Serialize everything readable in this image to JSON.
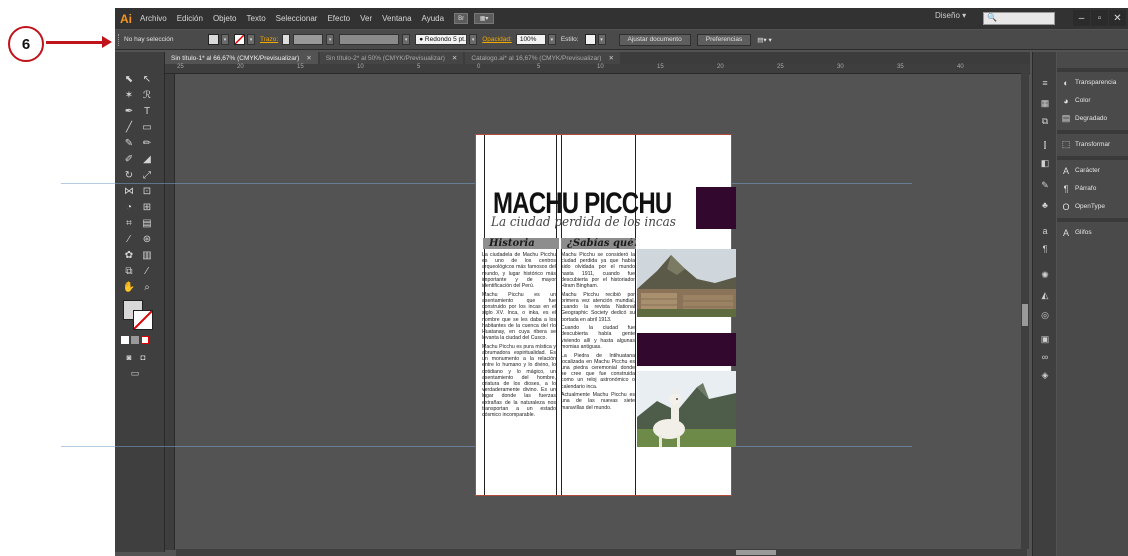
{
  "callout": {
    "number": "6"
  },
  "app": {
    "logo": "Ai",
    "menu": [
      "Archivo",
      "Edición",
      "Objeto",
      "Texto",
      "Seleccionar",
      "Efecto",
      "Ver",
      "Ventana",
      "Ayuda"
    ],
    "menu_buttons": [
      "Br",
      "▦▾"
    ],
    "workspace": "Diseño ▾",
    "search_placeholder": "🔍",
    "window_buttons": [
      "–",
      "▫",
      "✕"
    ]
  },
  "control_bar": {
    "selection": "No hay selección",
    "stroke_label": "Trazo:",
    "brush": "● Redondo 5 pt.",
    "opacity_label": "Opacidad:",
    "opacity_value": "100%",
    "style_label": "Estilo:",
    "doc_setup": "Ajustar documento",
    "prefs": "Preferencias",
    "arrange": "▤▾ ▾"
  },
  "tabs": [
    {
      "label": "Sin título-1* al 66,67% (CMYK/Previsualizar)",
      "close": "✕"
    },
    {
      "label": "Sin título-2* al 50% (CMYK/Previsualizar)",
      "close": "✕"
    },
    {
      "label": "Catalogo.ai* al 16,67% (CMYK/Previsualizar)",
      "close": "✕"
    }
  ],
  "ruler_labels": [
    "25",
    "20",
    "15",
    "10",
    "5",
    "0",
    "5",
    "10",
    "15",
    "20",
    "25",
    "30",
    "35",
    "40"
  ],
  "panels": [
    {
      "icon": "◐",
      "label": "Transparencia"
    },
    {
      "icon": "◕",
      "label": "Color"
    },
    {
      "icon": "▤",
      "label": "Degradado"
    },
    {
      "icon": "⬚",
      "label": "Transformar"
    },
    {
      "icon": "A",
      "label": "Carácter"
    },
    {
      "icon": "¶",
      "label": "Párrafo"
    },
    {
      "icon": "O",
      "label": "OpenType"
    },
    {
      "icon": "A",
      "label": "Glifos"
    }
  ],
  "document": {
    "title": "MACHU PICCHU",
    "subtitle": "La ciudad perdida de los incas",
    "col1_heading": "Historia",
    "col2_heading": "¿Sabías qué?",
    "col1_paragraphs": [
      "La ciudadela de Machu Picchu es uno de los centros arqueológicos más famosos del mundo, y lugar histórico más importante y de mayor identificación del Perú.",
      "Machu Picchu es un asentamiento que fue construido por los incas en el siglo XV. Inca, o inka, es el nombre que se les daba a los habitantes de la cuenca del río Huatanay, en cuya ribera se levanta la ciudad del Cusco.",
      "Machu Picchu es pura mística y abrumadora espiritualidad. Es un monumento a la relación entre lo humano y lo divino, lo cotidiano y lo mágico, un asentamiento del hombre, criatura de los dioses, a lo verdaderamente divino. Es un lugar donde las fuerzas extrañas de la naturaleza nos transportan a un estado cósmico incomparable."
    ],
    "col2_paragraphs": [
      "Machu Picchu se consideró la ciudad perdida ya que había sido olvidada por el mundo hasta 1911, cuando fue descubierta por el historiador Hiram Bingham.",
      "Machu Picchu recibió por primera vez atención mundial, cuando la revista National Geographic Society dedicó su portada en abril 1913.",
      "Cuando la ciudad fue descubierta había gente viviendo allí y hasta algunas momias antiguas.",
      "La Piedra de Intihuatana localizada en Machu Picchu es una piedra ceremonial donde se cree que fue construida como un reloj astronómico o calendario inca.",
      "Actualmente Machu Picchu es una de las nuevas siete maravillas del mundo."
    ]
  },
  "colors": {
    "purple": "#33082f",
    "accent_orange": "#f7941d",
    "callout_red": "#c0131b"
  }
}
